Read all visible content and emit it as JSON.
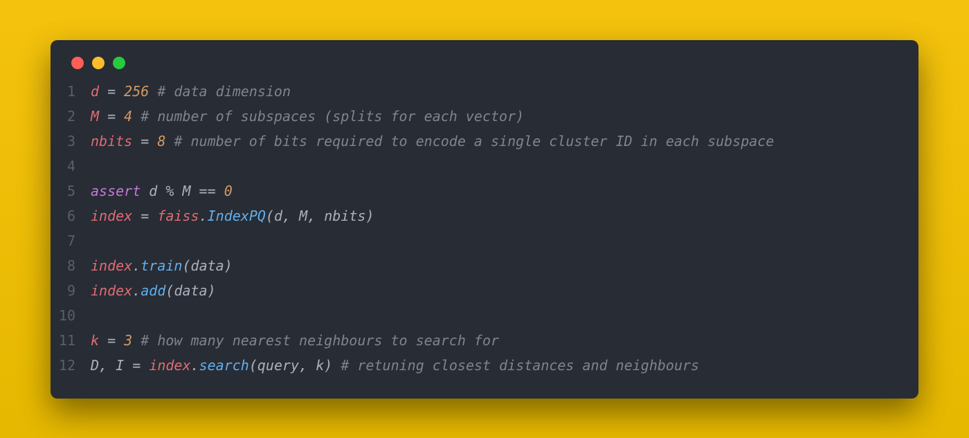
{
  "window": {
    "dots": [
      "red",
      "yellow",
      "green"
    ]
  },
  "code": {
    "lines": [
      {
        "n": "1",
        "tokens": [
          {
            "t": "d",
            "c": "tok-var"
          },
          {
            "t": " = ",
            "c": "tok-op"
          },
          {
            "t": "256",
            "c": "tok-num"
          },
          {
            "t": " ",
            "c": "tok-op"
          },
          {
            "t": "# data dimension",
            "c": "tok-com"
          }
        ]
      },
      {
        "n": "2",
        "tokens": [
          {
            "t": "M",
            "c": "tok-var"
          },
          {
            "t": " = ",
            "c": "tok-op"
          },
          {
            "t": "4",
            "c": "tok-num"
          },
          {
            "t": " ",
            "c": "tok-op"
          },
          {
            "t": "# number of subspaces (splits for each vector)",
            "c": "tok-com"
          }
        ]
      },
      {
        "n": "3",
        "tokens": [
          {
            "t": "nbits",
            "c": "tok-var"
          },
          {
            "t": " = ",
            "c": "tok-op"
          },
          {
            "t": "8",
            "c": "tok-num"
          },
          {
            "t": " ",
            "c": "tok-op"
          },
          {
            "t": "# number of bits required to encode a single cluster ID in each subspace",
            "c": "tok-com"
          }
        ]
      },
      {
        "n": "4",
        "tokens": []
      },
      {
        "n": "5",
        "tokens": [
          {
            "t": "assert",
            "c": "tok-kw"
          },
          {
            "t": " d ",
            "c": "tok-id"
          },
          {
            "t": "%",
            "c": "tok-op"
          },
          {
            "t": " M ",
            "c": "tok-id"
          },
          {
            "t": "==",
            "c": "tok-op"
          },
          {
            "t": " ",
            "c": "tok-op"
          },
          {
            "t": "0",
            "c": "tok-num"
          }
        ]
      },
      {
        "n": "6",
        "tokens": [
          {
            "t": "index",
            "c": "tok-var"
          },
          {
            "t": " = ",
            "c": "tok-op"
          },
          {
            "t": "faiss",
            "c": "tok-obj"
          },
          {
            "t": ".",
            "c": "tok-pun"
          },
          {
            "t": "IndexPQ",
            "c": "tok-fn"
          },
          {
            "t": "(",
            "c": "tok-pun"
          },
          {
            "t": "d",
            "c": "tok-id"
          },
          {
            "t": ", ",
            "c": "tok-pun"
          },
          {
            "t": "M",
            "c": "tok-id"
          },
          {
            "t": ", ",
            "c": "tok-pun"
          },
          {
            "t": "nbits",
            "c": "tok-id"
          },
          {
            "t": ")",
            "c": "tok-pun"
          }
        ]
      },
      {
        "n": "7",
        "tokens": []
      },
      {
        "n": "8",
        "tokens": [
          {
            "t": "index",
            "c": "tok-obj"
          },
          {
            "t": ".",
            "c": "tok-pun"
          },
          {
            "t": "train",
            "c": "tok-fn"
          },
          {
            "t": "(",
            "c": "tok-pun"
          },
          {
            "t": "data",
            "c": "tok-id"
          },
          {
            "t": ")",
            "c": "tok-pun"
          }
        ]
      },
      {
        "n": "9",
        "tokens": [
          {
            "t": "index",
            "c": "tok-obj"
          },
          {
            "t": ".",
            "c": "tok-pun"
          },
          {
            "t": "add",
            "c": "tok-fn"
          },
          {
            "t": "(",
            "c": "tok-pun"
          },
          {
            "t": "data",
            "c": "tok-id"
          },
          {
            "t": ")",
            "c": "tok-pun"
          }
        ]
      },
      {
        "n": "10",
        "tokens": []
      },
      {
        "n": "11",
        "tokens": [
          {
            "t": "k",
            "c": "tok-var"
          },
          {
            "t": " = ",
            "c": "tok-op"
          },
          {
            "t": "3",
            "c": "tok-num"
          },
          {
            "t": " ",
            "c": "tok-op"
          },
          {
            "t": "# how many nearest neighbours to search for",
            "c": "tok-com"
          }
        ]
      },
      {
        "n": "12",
        "tokens": [
          {
            "t": "D",
            "c": "tok-id"
          },
          {
            "t": ", ",
            "c": "tok-pun"
          },
          {
            "t": "I",
            "c": "tok-id"
          },
          {
            "t": " = ",
            "c": "tok-op"
          },
          {
            "t": "index",
            "c": "tok-obj"
          },
          {
            "t": ".",
            "c": "tok-pun"
          },
          {
            "t": "search",
            "c": "tok-fn"
          },
          {
            "t": "(",
            "c": "tok-pun"
          },
          {
            "t": "query",
            "c": "tok-id"
          },
          {
            "t": ", ",
            "c": "tok-pun"
          },
          {
            "t": "k",
            "c": "tok-id"
          },
          {
            "t": ")",
            "c": "tok-pun"
          },
          {
            "t": " ",
            "c": "tok-op"
          },
          {
            "t": "# retuning closest distances and neighbours",
            "c": "tok-com"
          }
        ]
      }
    ]
  }
}
